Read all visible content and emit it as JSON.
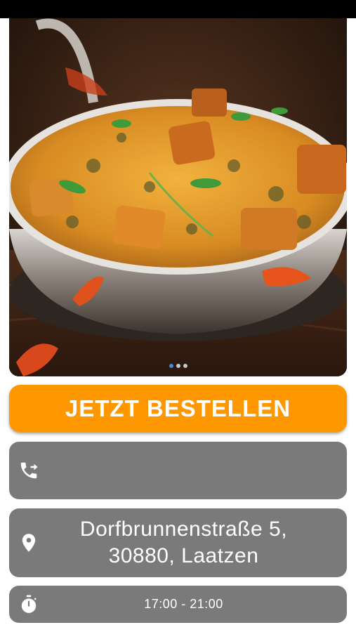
{
  "app": {
    "colors": {
      "accent": "#ff9800",
      "card": "#7a7a7a",
      "dot_active": "#3d8ee0",
      "dot_inactive": "#c8c8c8"
    }
  },
  "carousel": {
    "image_alt": "Curry-Gericht in einer Metallschale",
    "slide_count": 3,
    "active_index": 0
  },
  "actions": {
    "order_label": "JETZT BESTELLEN"
  },
  "contact": {
    "phone_icon": "phone-forward-icon",
    "phone_value": "",
    "address_icon": "location-pin-icon",
    "address_line1": "Dorfbrunnenstraße 5,",
    "address_line2": "30880, Laatzen",
    "hours_icon": "stopwatch-icon",
    "hours_value": "17:00 - 21:00"
  }
}
